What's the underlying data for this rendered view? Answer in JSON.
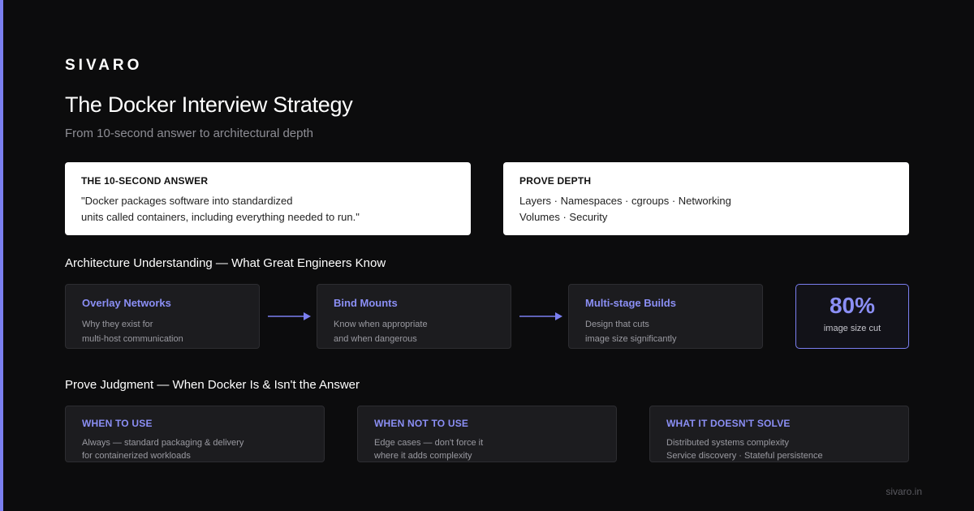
{
  "brand": "SIVARO",
  "title": "The Docker Interview Strategy",
  "subtitle": "From 10-second answer to architectural depth",
  "quick_answer": {
    "heading": "THE 10-SECOND ANSWER",
    "lines": [
      "\"Docker packages software into standardized",
      "units called containers, including everything needed to run.\""
    ]
  },
  "prove_depth": {
    "heading": "PROVE DEPTH",
    "lines": [
      "Layers · Namespaces · cgroups · Networking",
      "Volumes · Security"
    ]
  },
  "architecture": {
    "title": "Architecture Understanding — What Great Engineers Know",
    "cards": [
      {
        "title": "Overlay Networks",
        "lines": [
          "Why they exist for",
          "multi-host communication"
        ]
      },
      {
        "title": "Bind Mounts",
        "lines": [
          "Know when appropriate",
          "and when dangerous"
        ]
      },
      {
        "title": "Multi-stage Builds",
        "lines": [
          "Design that cuts",
          "image size significantly"
        ]
      }
    ],
    "stat": {
      "value": "80%",
      "label": "image size cut"
    }
  },
  "judgment": {
    "title": "Prove Judgment — When Docker Is & Isn't the Answer",
    "cards": [
      {
        "title": "WHEN TO USE",
        "lines": [
          "Always — standard packaging & delivery",
          "for containerized workloads"
        ]
      },
      {
        "title": "WHEN NOT TO USE",
        "lines": [
          "Edge cases — don't force it",
          "where it adds complexity"
        ]
      },
      {
        "title": "WHAT IT DOESN'T SOLVE",
        "lines": [
          "Distributed systems complexity",
          "Service discovery · Stateful persistence"
        ]
      }
    ]
  },
  "footer": "sivaro.in",
  "colors": {
    "accent": "#7b7ff0",
    "background": "#0c0c0d",
    "card": "#1c1c1f"
  }
}
